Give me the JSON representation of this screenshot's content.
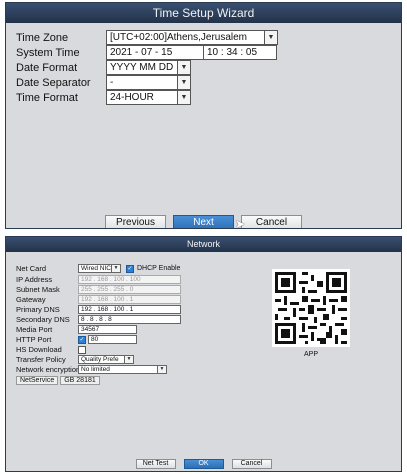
{
  "time_wizard": {
    "title": "Time Setup Wizard",
    "time_zone_label": "Time Zone",
    "time_zone_value": "[UTC+02:00]Athens,Jerusalem",
    "system_time_label": "System Time",
    "system_date": "2021 - 07 - 15",
    "system_clock": "10 : 34 : 05",
    "date_format_label": "Date Format",
    "date_format_value": "YYYY MM DD",
    "date_separator_label": "Date Separator",
    "date_separator_value": "-",
    "time_format_label": "Time Format",
    "time_format_value": "24-HOUR",
    "previous_label": "Previous",
    "next_label": "Next",
    "cancel_label": "Cancel"
  },
  "network": {
    "title": "Network",
    "net_card_label": "Net Card",
    "net_card_value": "Wired NIC",
    "dhcp_label": "DHCP Enable",
    "dhcp_checked": true,
    "ip_label": "IP Address",
    "ip_value": "192 . 168 . 100 . 100",
    "mask_label": "Subnet Mask",
    "mask_value": "255 . 255 . 255 . 0",
    "gateway_label": "Gateway",
    "gateway_value": "192 . 168 . 100 . 1",
    "dns1_label": "Primary DNS",
    "dns1_value": "192 . 168 . 100 . 1",
    "dns2_label": "Secondary DNS",
    "dns2_value": "8 . 8 . 8 . 8",
    "media_port_label": "Media Port",
    "media_port_value": "34567",
    "http_port_label": "HTTP Port",
    "http_port_value": "80",
    "hs_download_label": "HS Download",
    "transfer_label": "Transfer Policy",
    "transfer_value": "Quality Prefe",
    "encryption_label": "Network encryption",
    "encryption_value": "No limited",
    "netservice_label": "NetService",
    "gb_label": "GB 28181",
    "app_label": "APP",
    "net_test_label": "Net Test",
    "ok_label": "OK",
    "cancel_label": "Cancel"
  },
  "colors": {
    "accent": "#2b6fb7",
    "titlebar": "#22324a",
    "panel": "#d9dadd"
  }
}
